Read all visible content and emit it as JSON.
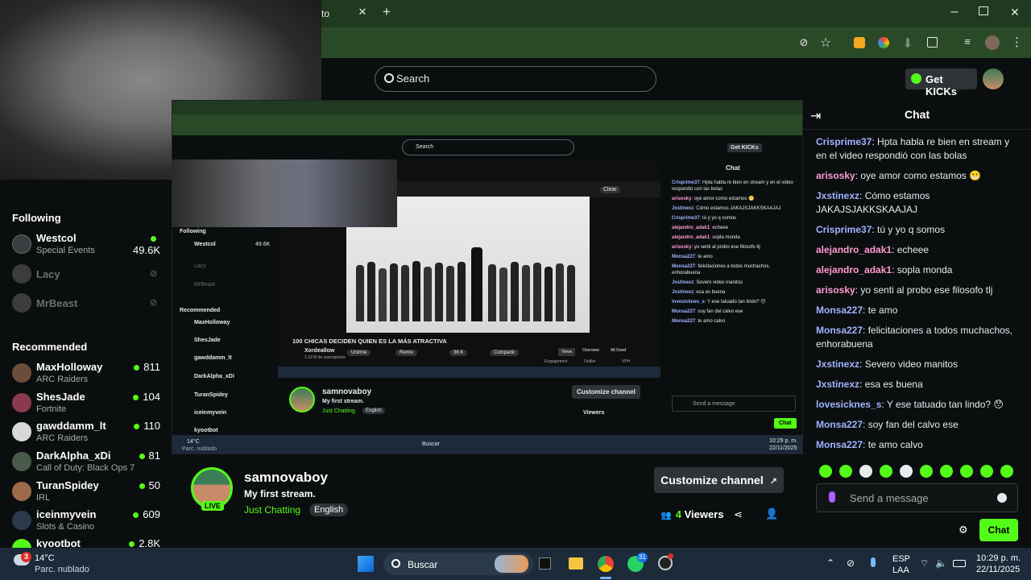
{
  "browser": {
    "tab_title": "to",
    "colors": {
      "tabbar": "#1f3a1f",
      "toolbar": "#2a4a27"
    }
  },
  "header": {
    "search_placeholder": "Search",
    "get_kicks_label": "Get KICKs"
  },
  "sidebar": {
    "following_title": "Following",
    "following": [
      {
        "name": "Westcol",
        "sub": "Special Events",
        "count": "49.6K",
        "live": true
      },
      {
        "name": "Lacy",
        "sub": "",
        "count": "",
        "live": false
      },
      {
        "name": "MrBeast",
        "sub": "",
        "count": "",
        "live": false
      }
    ],
    "recommended_title": "Recommended",
    "recommended": [
      {
        "name": "MaxHolloway",
        "sub": "ARC Raiders",
        "count": "811"
      },
      {
        "name": "ShesJade",
        "sub": "Fortnite",
        "count": "104"
      },
      {
        "name": "gawddamm_lt",
        "sub": "ARC Raiders",
        "count": "110"
      },
      {
        "name": "DarkAlpha_xDi",
        "sub": "Call of Duty: Black Ops 7",
        "count": "81"
      },
      {
        "name": "TuranSpidey",
        "sub": "IRL",
        "count": "50"
      },
      {
        "name": "iceinmyvein",
        "sub": "Slots & Casino",
        "count": "609"
      },
      {
        "name": "kyootbot",
        "sub": "",
        "count": "2.8K"
      }
    ]
  },
  "stream": {
    "username": "samnovaboy",
    "title": "My first stream.",
    "category": "Just Chatting",
    "language": "English",
    "live_badge": "LIVE",
    "customize_label": "Customize channel",
    "viewers_count": "4",
    "viewers_label": "Viewers"
  },
  "chat": {
    "title": "Chat",
    "input_placeholder": "Send a message",
    "send_label": "Chat",
    "messages": [
      {
        "user": "Crisprime37",
        "color": "#a0b4ff",
        "text": "Hpta habla re bien en stream y en el video respondió con las bolas"
      },
      {
        "user": "arisosky",
        "color": "#ff9ad0",
        "text": "oye amor como estamos 😬"
      },
      {
        "user": "Jxstinexz",
        "color": "#a0b4ff",
        "text": "Cómo estamos JAKAJSJAKKSKAAJAJ"
      },
      {
        "user": "Crisprime37",
        "color": "#a0b4ff",
        "text": "tú y yo q somos"
      },
      {
        "user": "alejandro_adak1",
        "color": "#ff9ad0",
        "text": "echeee"
      },
      {
        "user": "alejandro_adak1",
        "color": "#ff9ad0",
        "text": "sopla monda"
      },
      {
        "user": "arisosky",
        "color": "#ff9ad0",
        "text": "yo senti al probo ese filosofo tlj"
      },
      {
        "user": "Monsa227",
        "color": "#a0b4ff",
        "text": "te amo"
      },
      {
        "user": "Monsa227",
        "color": "#a0b4ff",
        "text": "felicitaciones a todos muchachos, enhorabuena"
      },
      {
        "user": "Jxstinexz",
        "color": "#a0b4ff",
        "text": "Severo video manitos"
      },
      {
        "user": "Jxstinexz",
        "color": "#a0b4ff",
        "text": "esa es buena"
      },
      {
        "user": "lovesicknes_s",
        "color": "#a0b4ff",
        "text": "Y ese tatuado tan lindo? 😯"
      },
      {
        "user": "Monsa227",
        "color": "#a0b4ff",
        "text": "soy fan del calvo ese"
      },
      {
        "user": "Monsa227",
        "color": "#a0b4ff",
        "text": "te amo calvo"
      }
    ]
  },
  "nested": {
    "video_title": "100 CHICAS DECIDEN QUIEN ES LA MÁS ATRACTIVA",
    "channel": "Xordeallow",
    "subs": "1.22 M de suscriptores",
    "join": "Unirme",
    "remix": "Remix",
    "likes": "36 K",
    "share": "Compartir",
    "views": "Views",
    "overview": "Overview",
    "all_good": "All Good",
    "chip_label": "Engagement",
    "chip_outlier": "Outlier",
    "chip_vph": "VPH",
    "clear": "Clear"
  },
  "taskbar": {
    "weather_temp": "14°C",
    "weather_desc": "Parc. nublado",
    "search_label": "Buscar",
    "lang_top": "ESP",
    "lang_bottom": "LAA",
    "time": "10:29 p. m.",
    "date": "22/11/2025",
    "notif_badge": "3",
    "whatsapp_badge": "31"
  }
}
